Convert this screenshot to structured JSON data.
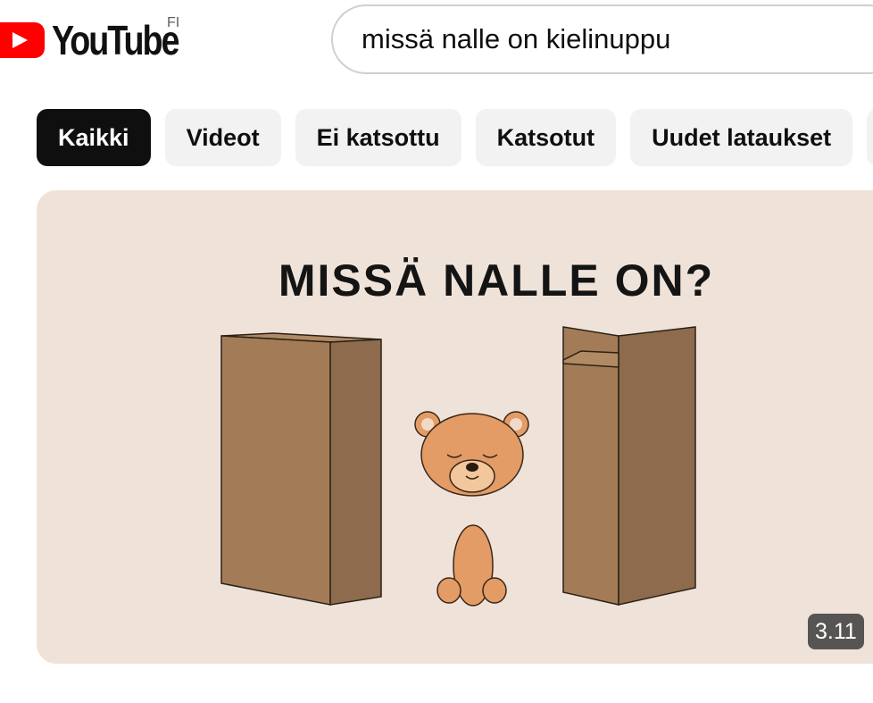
{
  "header": {
    "logo_text": "YouTube",
    "region_code": "FI",
    "search_value": "missä nalle on kielinuppu"
  },
  "chips": [
    {
      "label": "Kaikki",
      "active": true
    },
    {
      "label": "Videot",
      "active": false
    },
    {
      "label": "Ei katsottu",
      "active": false
    },
    {
      "label": "Katsotut",
      "active": false
    },
    {
      "label": "Uudet lataukset",
      "active": false
    }
  ],
  "video": {
    "thumbnail_title": "MISSÄ NALLE ON?",
    "duration": "3.11"
  },
  "colors": {
    "brand_red": "#ff0000",
    "thumbnail_bg": "#efe3d9",
    "box_front": "#a37c57",
    "box_side": "#8d6b4c",
    "bear": "#e39c66"
  },
  "icons": {
    "logo": "youtube-play-icon"
  }
}
